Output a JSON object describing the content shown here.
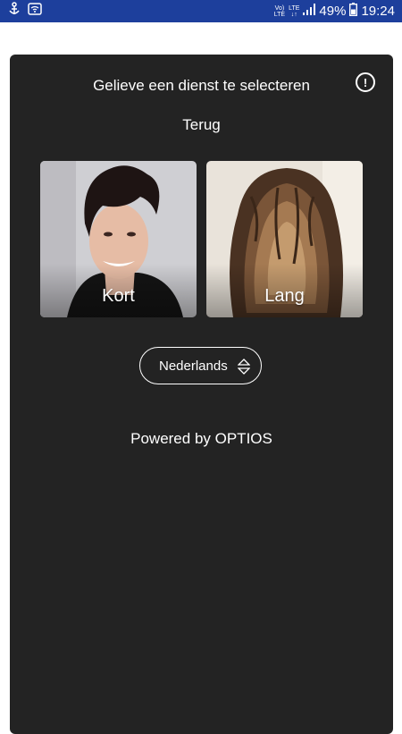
{
  "status_bar": {
    "net_label_top": "Vo)",
    "net_label_bottom": "LTE",
    "signal_label_top": "LTE",
    "signal_label_bottom": "↓↑",
    "battery": "49%",
    "time": "19:24",
    "icons": [
      "android-debug-icon",
      "wifi-icon",
      "signal-icon",
      "battery-icon"
    ]
  },
  "header": {
    "title": "Gelieve een dienst te selecteren",
    "info_icon": "exclamation-circle-icon"
  },
  "back_label": "Terug",
  "services": [
    {
      "label": "Kort"
    },
    {
      "label": "Lang"
    }
  ],
  "language": {
    "selected": "Nederlands",
    "icon": "sort-arrows-icon"
  },
  "footer": {
    "powered_by": "Powered by OPTIOS"
  },
  "colors": {
    "status_bar": "#1d3f9c",
    "card_background": "#232323",
    "text": "#ffffff"
  }
}
